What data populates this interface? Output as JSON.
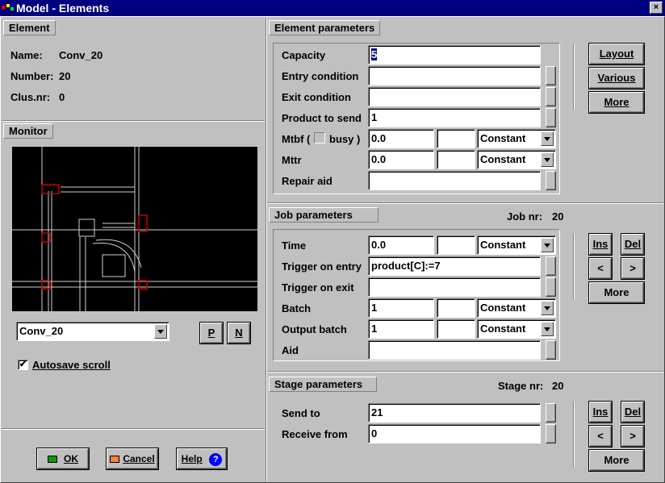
{
  "window": {
    "title": "Model - Elements",
    "close_label": "×"
  },
  "element": {
    "section_title": "Element",
    "name_label": "Name:",
    "name_value": "Conv_20",
    "number_label": "Number:",
    "number_value": "20",
    "clusnr_label": "Clus.nr:",
    "clusnr_value": "0"
  },
  "monitor": {
    "section_title": "Monitor",
    "selected": "Conv_20",
    "p_button": "P",
    "n_button": "N",
    "autosave_label": "Autosave scroll",
    "autosave_checked": "✔"
  },
  "footer": {
    "ok_label": "OK",
    "cancel_label": "Cancel",
    "help_label": "Help",
    "help_icon": "?"
  },
  "element_parameters": {
    "section_title": "Element parameters",
    "capacity_label": "Capacity",
    "capacity_value": "5",
    "entry_label": "Entry condition",
    "entry_value": "",
    "exit_label": "Exit condition",
    "exit_value": "",
    "product_label": "Product to send",
    "product_value": "1",
    "mtbf_label": "Mtbf (",
    "mtbf_busy": "busy )",
    "mtbf_value": "0.0",
    "mtbf_mid": "",
    "mtbf_dist": "Constant",
    "mttr_label": "Mttr",
    "mttr_value": "0.0",
    "mttr_mid": "",
    "mttr_dist": "Constant",
    "repair_label": "Repair aid",
    "repair_value": "",
    "layout_button": "Layout",
    "various_button": "Various",
    "more_button": "More"
  },
  "job_parameters": {
    "section_title": "Job parameters",
    "jobnr_label": "Job nr:",
    "jobnr_value": "20",
    "time_label": "Time",
    "time_value": "0.0",
    "time_mid": "",
    "time_dist": "Constant",
    "trigger_entry_label": "Trigger on entry",
    "trigger_entry_value": "product[C]:=7",
    "trigger_exit_label": "Trigger on exit",
    "trigger_exit_value": "",
    "batch_label": "Batch",
    "batch_value": "1",
    "batch_mid": "",
    "batch_dist": "Constant",
    "output_batch_label": "Output batch",
    "output_batch_value": "1",
    "output_batch_mid": "",
    "output_batch_dist": "Constant",
    "aid_label": "Aid",
    "aid_value": "",
    "ins_button": "Ins",
    "del_button": "Del",
    "prev_button": "<",
    "next_button": ">",
    "more_button": "More"
  },
  "stage_parameters": {
    "section_title": "Stage parameters",
    "stagenr_label": "Stage nr:",
    "stagenr_value": "20",
    "send_to_label": "Send to",
    "send_to_value": "21",
    "receive_from_label": "Receive from",
    "receive_from_value": "0",
    "ins_button": "Ins",
    "del_button": "Del",
    "prev_button": "<",
    "next_button": ">",
    "more_button": "More"
  },
  "colors": {
    "titlebar": "#000080",
    "face": "#c0c0c0",
    "monitor_bg": "#000000",
    "monitor_lines": "#d0d0d0",
    "monitor_highlight": "#c00000",
    "help_icon": "#0000ff",
    "ok_icon": "#00a000"
  }
}
